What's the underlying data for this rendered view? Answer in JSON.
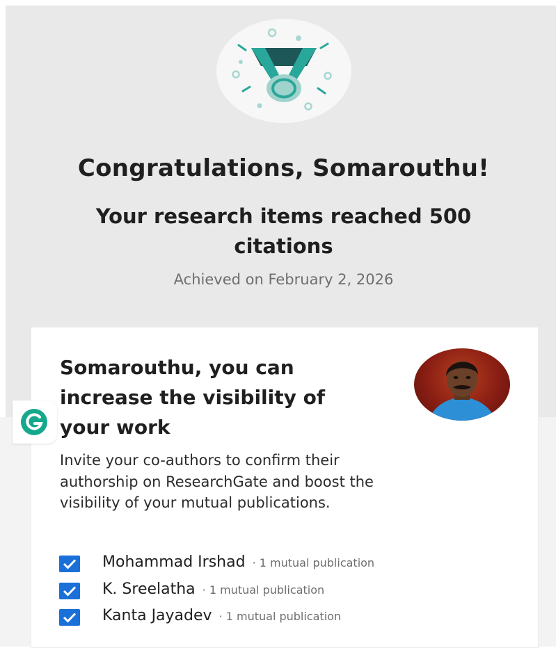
{
  "achievement": {
    "badge_icon": "medal-icon",
    "headline": "Congratulations, Somarouthu!",
    "subhead": "Your research items reached 500 citations",
    "achieved_on": "Achieved on February 2, 2026"
  },
  "card": {
    "title": "Somarouthu, you can increase the visibility of your work",
    "avatar_icon": "profile-photo",
    "body": "Invite your co-authors to confirm their authorship on ResearchGate and boost the visibility of your mutual publications.",
    "coauthors": [
      {
        "name": "Mohammad Irshad",
        "meta": "· 1 mutual publication",
        "checked": true
      },
      {
        "name": "K. Sreelatha",
        "meta": "· 1 mutual publication",
        "checked": true
      },
      {
        "name": "Kanta Jayadev",
        "meta": "· 1 mutual publication",
        "checked": true
      }
    ]
  },
  "overlay": {
    "grammarly_icon": "grammarly-icon"
  },
  "colors": {
    "accent_teal": "#2aa79b",
    "dark_teal": "#1e5757",
    "checkbox_blue": "#1a6fd8",
    "band_gray": "#e9e9e9"
  }
}
